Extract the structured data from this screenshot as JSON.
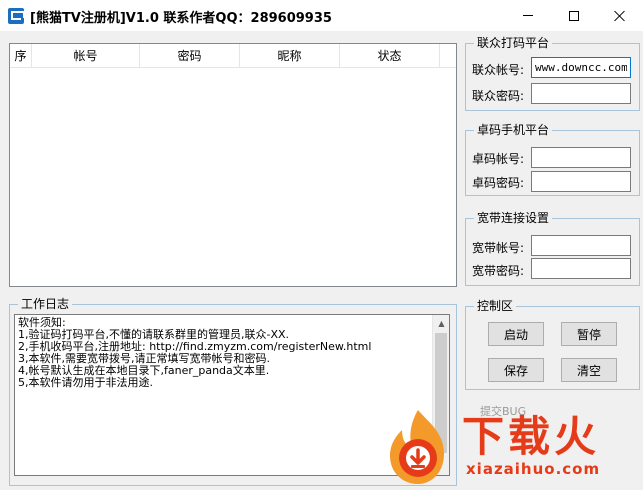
{
  "window": {
    "title": "[熊猫TV注册机]V1.0 联系作者QQ：289609935",
    "icon": "app-icon"
  },
  "account_list": {
    "columns": [
      "序",
      "帐号",
      "密码",
      "昵称",
      "状态"
    ],
    "rows": []
  },
  "platform_lianzhong": {
    "legend": "联众打码平台",
    "account_label": "联众帐号:",
    "account_value": "www.downcc.com",
    "password_label": "联众密码:",
    "password_value": ""
  },
  "platform_zhuoma": {
    "legend": "卓码手机平台",
    "account_label": "卓码帐号:",
    "account_value": "",
    "password_label": "卓码密码:",
    "password_value": ""
  },
  "broadband": {
    "legend": "宽带连接设置",
    "account_label": "宽带帐号:",
    "account_value": "",
    "password_label": "宽带密码:",
    "password_value": ""
  },
  "work_log": {
    "legend": "工作日志",
    "text": "软件须知:\n1,验证码打码平台,不懂的请联系群里的管理员,联众-XX.\n2,手机收码平台,注册地址: http://find.zmyzm.com/registerNew.html\n3,本软件,需要宽带拨号,请正常填写宽带帐号和密码.\n4,帐号默认生成在本地目录下,faner_panda文本里.\n5,本软件请勿用于非法用途."
  },
  "control": {
    "legend": "控制区",
    "start_label": "启动",
    "pause_label": "暂停",
    "save_label": "保存",
    "clear_label": "清空"
  },
  "bug_label": "提交BUG",
  "watermark": {
    "cn": "下载火",
    "en": "xiazaihuo.com",
    "colors": {
      "orange": "#f39a2b",
      "red": "#e63b19"
    }
  }
}
